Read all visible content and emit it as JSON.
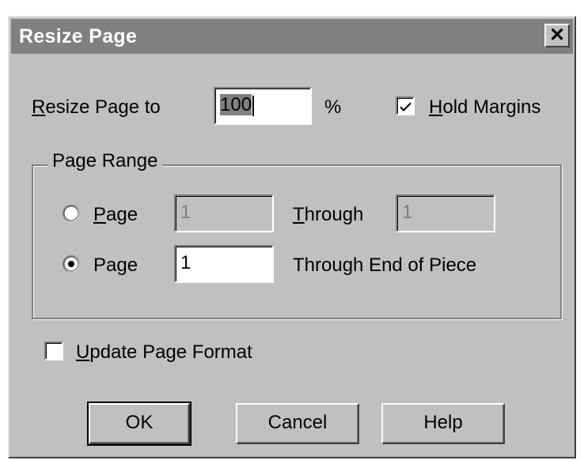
{
  "window": {
    "title": "Resize Page",
    "close_glyph": "✕"
  },
  "resize": {
    "label_accel": "R",
    "label_rest": "esize Page to",
    "value": "100",
    "unit": "%"
  },
  "hold_margins": {
    "label_accel": "H",
    "label_rest": "old Margins",
    "checked": true
  },
  "page_range": {
    "legend": "Page Range",
    "option1": {
      "label_accel": "P",
      "label_rest": "age",
      "from_value": "1",
      "through_accel": "T",
      "through_rest": "hrough",
      "to_value": "1",
      "selected": false
    },
    "option2": {
      "label_pre": "Pa",
      "label_accel": "g",
      "label_rest": "e",
      "from_value": "1",
      "through_text": "Through End of Piece",
      "selected": true
    }
  },
  "update_format": {
    "label_accel": "U",
    "label_rest": "pdate Page Format",
    "checked": false
  },
  "buttons": {
    "ok": "OK",
    "cancel": "Cancel",
    "help": "Help"
  },
  "icons": {
    "close": "close-icon",
    "check": "checkmark-icon",
    "radio_on": "radio-selected-icon",
    "radio_off": "radio-unselected-icon"
  }
}
